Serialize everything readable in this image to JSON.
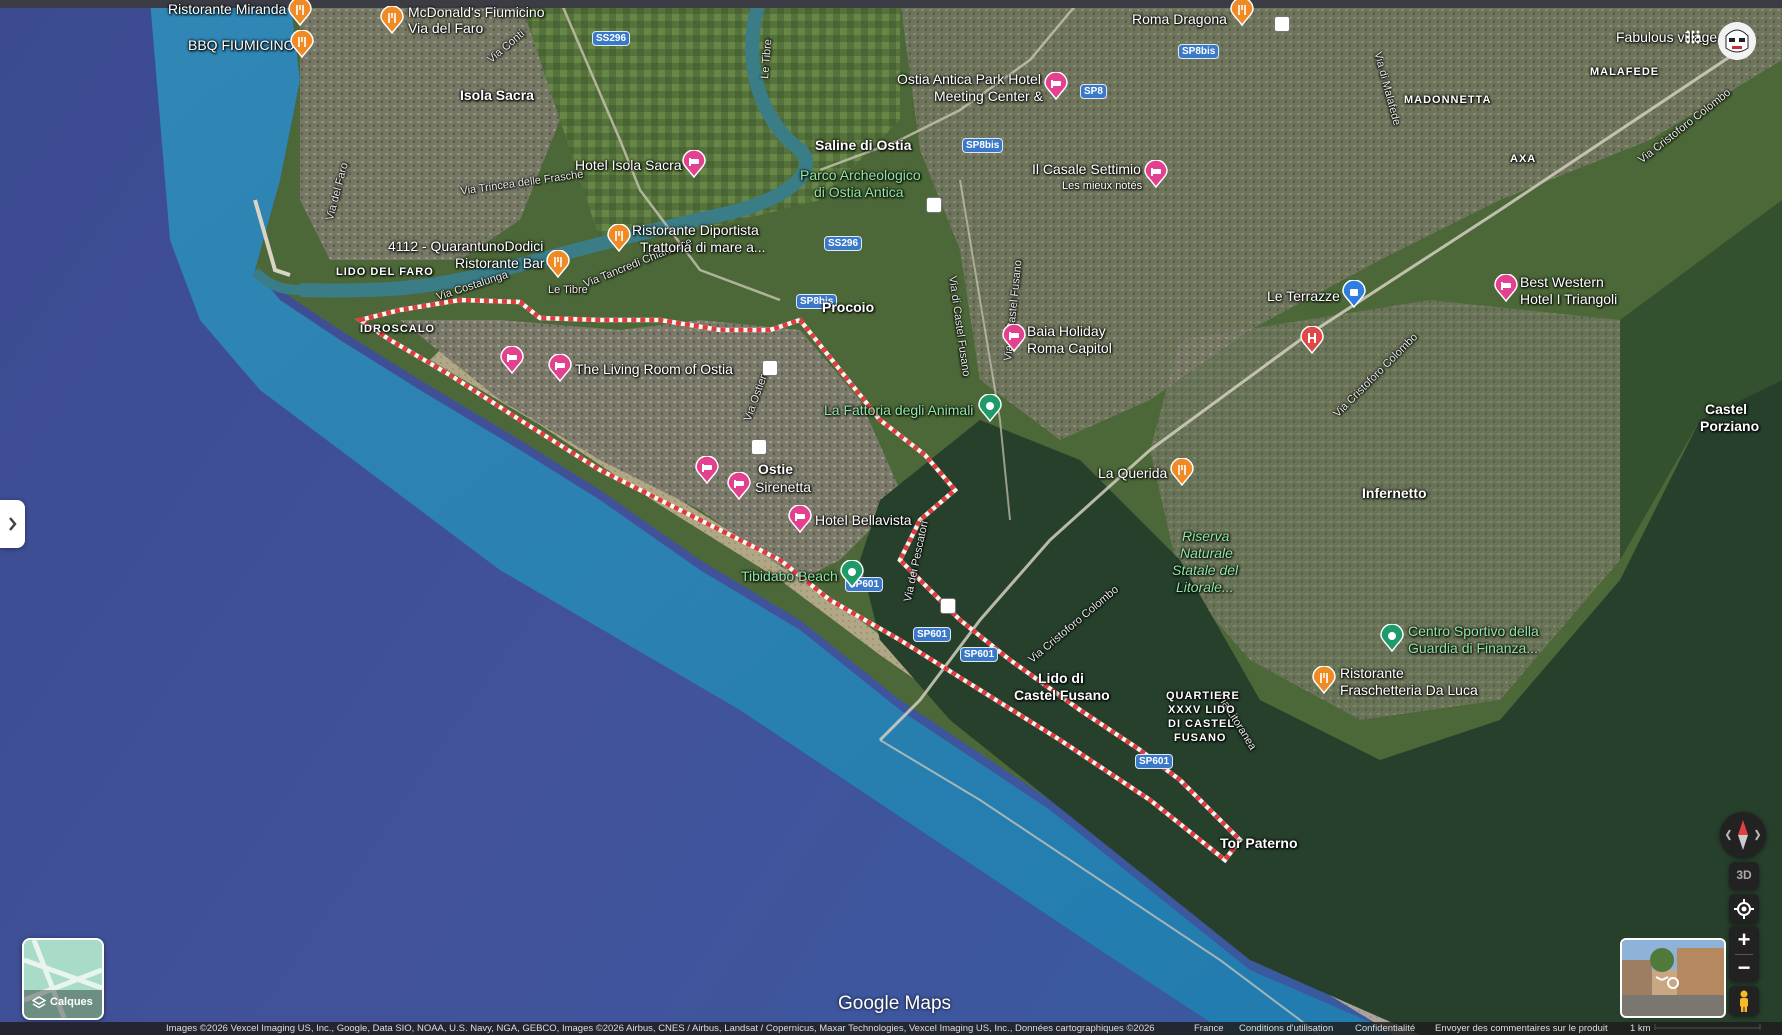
{
  "map": {
    "provider_logo": "Google Maps",
    "attribution": "Images ©2026 Vexcel Imaging US, Inc., Google, Data SIO, NOAA, U.S. Navy, NGA, GEBCO, Images ©2026 Airbus, CNES / Airbus, Landsat / Copernicus, Maxar Technologies, Vexcel Imaging US, Inc., Données cartographiques ©2026",
    "footer_links": [
      "France",
      "Conditions d'utilisation",
      "Confidentialité",
      "Envoyer des commentaires sur le produit"
    ],
    "scale_label": "1 km",
    "view_mode": "satellite",
    "highlighted_area": "Ostia"
  },
  "places": {
    "ristorante_miranda": "Ristorante Miranda",
    "mcdonalds": "McDonald's Fiumicino",
    "mcdonalds_2": "Via del Faro",
    "bbq": "BBQ FIUMICINO",
    "roma_dragona": "Roma Dragona",
    "fabulous": "Fabulous village",
    "isola_sacra": "Isola Sacra",
    "ostia_antica_hotel": "Ostia Antica Park Hotel",
    "ostia_antica_hotel_2": "Meeting Center &",
    "malafede": "MALAFEDE",
    "madonnetta": "MADONNETTA",
    "saline": "Saline di Ostia",
    "hotel_isola_sacra": "Hotel Isola Sacra",
    "parco": "Parco Archeologico",
    "parco_2": "di Ostia Antica",
    "casale": "Il Casale Settimio",
    "casale_2": "Les mieux notés",
    "axa": "AXA",
    "quarantuno": "4112 - QuarantunoDodici",
    "quarantuno_2": "Ristorante Bar",
    "diportista": "Ristorante Diportista",
    "diportista_2": "Trattoria di mare a...",
    "lido_faro": "LIDO DEL FARO",
    "procoio": "Procoio",
    "terrazze": "Le Terrazze",
    "best_western": "Best Western",
    "best_western_2": "Hotel I Triangoli",
    "idroscalo": "IDROSCALO",
    "baia": "Baia Holiday",
    "baia_2": "Roma Capitol",
    "living_room": "The Living Room of Ostia",
    "fattoria": "La Fattoria degli Animali",
    "castel_porziano": "Castel",
    "castel_porziano_2": "Porziano",
    "querida": "La Querida",
    "ostia": "Ostie",
    "sirenetta": "Sirenetta",
    "infernetto": "Infernetto",
    "bellavista": "Hotel Bellavista",
    "riserva": "Riserva",
    "riserva_2": "Naturale",
    "riserva_3": "Statale del",
    "riserva_4": "Litorale...",
    "tibidabo": "Tibidabo Beach",
    "centro": "Centro Sportivo della",
    "centro_2": "Guardia di Finanza...",
    "lido_castel": "Lido di",
    "lido_castel_2": "Castel Fusano",
    "fraschetteria": "Ristorante",
    "fraschetteria_2": "Fraschetteria Da Luca",
    "quartiere": "QUARTIERE",
    "quartiere_2": "XXXV LIDO",
    "quartiere_3": "DI CASTEL",
    "quartiere_4": "FUSANO",
    "tor_paterno": "Tor Paterno"
  },
  "roads": {
    "via_del_faro": "Via del Faro",
    "via_trincea": "Via Trincea delle Frasche",
    "via_costalunga": "Via Costalunga",
    "via_tancredi": "Via Tancredi Chiaraluce",
    "le_tibre": "Le Tibre",
    "le_tibre_2": "Le Tibre",
    "via_castel_fusano": "Via di Castel Fusano",
    "via_castel_fusano_2": "Via di Castel Fusano",
    "via_ostiense": "Via Ostiense",
    "via_pescatori": "Via dei Pescatori",
    "via_colombo": "Via Cristoforo Colombo",
    "via_colombo_2": "Via Cristoforo Colombo",
    "via_colombo_3": "Via Cristoforo Colombo",
    "via_colombo_4": "Via Cristoforo Colombo",
    "via_litoranea": "Via Litoranea",
    "via_sorasina": "Via di Malafede",
    "via_conti": "Via Conti"
  },
  "shields": {
    "ss296_a": "SS296",
    "ss296_b": "SS296",
    "sp8bis_a": "SP8bis",
    "sp8bis_b": "SP8bis",
    "sp8bis_c": "SP8bis",
    "sp8": "SP8",
    "sp601_a": "SP601",
    "sp601_b": "SP601",
    "sp601_c": "SP601",
    "sp601_d": "SP601"
  },
  "controls": {
    "layers_label": "Calques",
    "three_d": "3D",
    "zoom_in": "+",
    "zoom_out": "−"
  },
  "colors": {
    "sea_deep": "#3b4a8c",
    "sea_shallow": "#2f8fb6",
    "land_green": "#4f6b3a",
    "urban": "#8a8675",
    "forest": "#27402c",
    "boundary": "#e33b3b",
    "pin_hotel": "#e3418f",
    "pin_food": "#f08a24",
    "pin_park": "#1e9b6a",
    "pin_shop": "#2d7ee0",
    "pin_hospital": "#e04848"
  }
}
